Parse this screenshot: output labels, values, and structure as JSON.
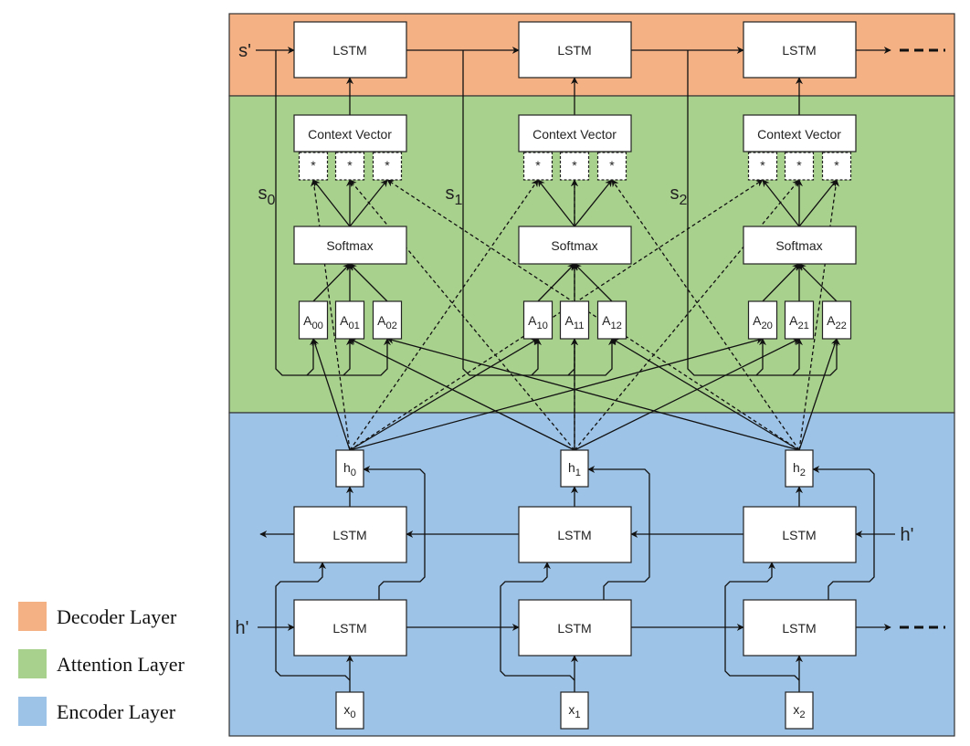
{
  "colors": {
    "decoder": "#F4B183",
    "attention": "#A9D18E",
    "encoder": "#9DC3E6"
  },
  "legend": [
    {
      "label": "Decoder Layer",
      "color": "#F4B183"
    },
    {
      "label": "Attention Layer",
      "color": "#A9D18E"
    },
    {
      "label": "Encoder Layer",
      "color": "#9DC3E6"
    }
  ],
  "decoder": {
    "input_label": "s'",
    "cell_label": "LSTM"
  },
  "attention": {
    "context_label": "Context Vector",
    "product_label": "*",
    "softmax_label": "Softmax",
    "state_labels": [
      [
        "s",
        "0"
      ],
      [
        "s",
        "1"
      ],
      [
        "s",
        "2"
      ]
    ],
    "scores": [
      [
        [
          "A",
          "00"
        ],
        [
          "A",
          "01"
        ],
        [
          "A",
          "02"
        ]
      ],
      [
        [
          "A",
          "10"
        ],
        [
          "A",
          "11"
        ],
        [
          "A",
          "12"
        ]
      ],
      [
        [
          "A",
          "20"
        ],
        [
          "A",
          "21"
        ],
        [
          "A",
          "22"
        ]
      ]
    ]
  },
  "encoder": {
    "cell_label": "LSTM",
    "hidden": [
      [
        "h",
        "0"
      ],
      [
        "h",
        "1"
      ],
      [
        "h",
        "2"
      ]
    ],
    "inputs": [
      [
        "x",
        "0"
      ],
      [
        "x",
        "1"
      ],
      [
        "x",
        "2"
      ]
    ],
    "backward_input_label": "h'",
    "forward_input_label": "h'"
  }
}
